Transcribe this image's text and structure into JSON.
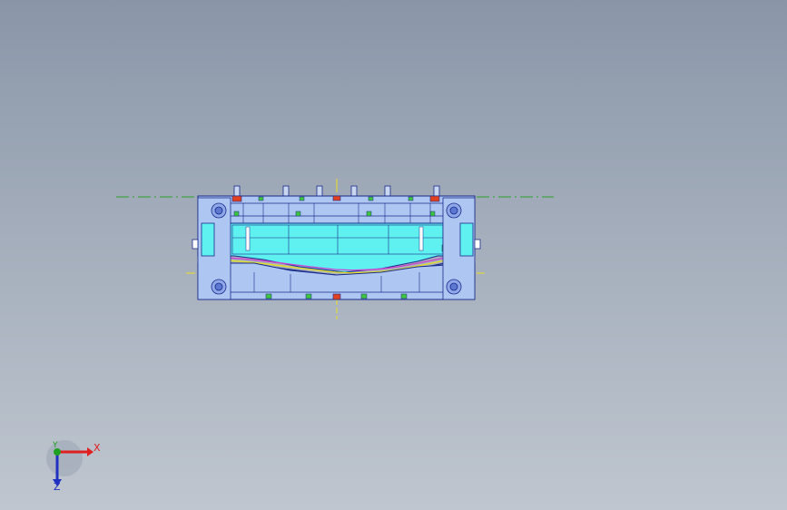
{
  "viewport": {
    "background_top": "#8a96a8",
    "background_bottom": "#bfc6cf"
  },
  "model": {
    "view": "section-view",
    "colors": {
      "outline": "#1a2a8a",
      "plate": "#aec6f2",
      "cavity": "#5ff0f0",
      "highlight_red": "#e04020",
      "accent_green": "#3ec43e",
      "accent_magenta": "#d040d0",
      "accent_yellow": "#e8e020",
      "centerline": "#2aa02a",
      "centerline_v": "#e8e020"
    }
  },
  "triad": {
    "x_label": "X",
    "y_label": "Y",
    "z_label": "Z",
    "x_color": "#e02020",
    "y_color": "#20a020",
    "z_color": "#2030c0"
  }
}
